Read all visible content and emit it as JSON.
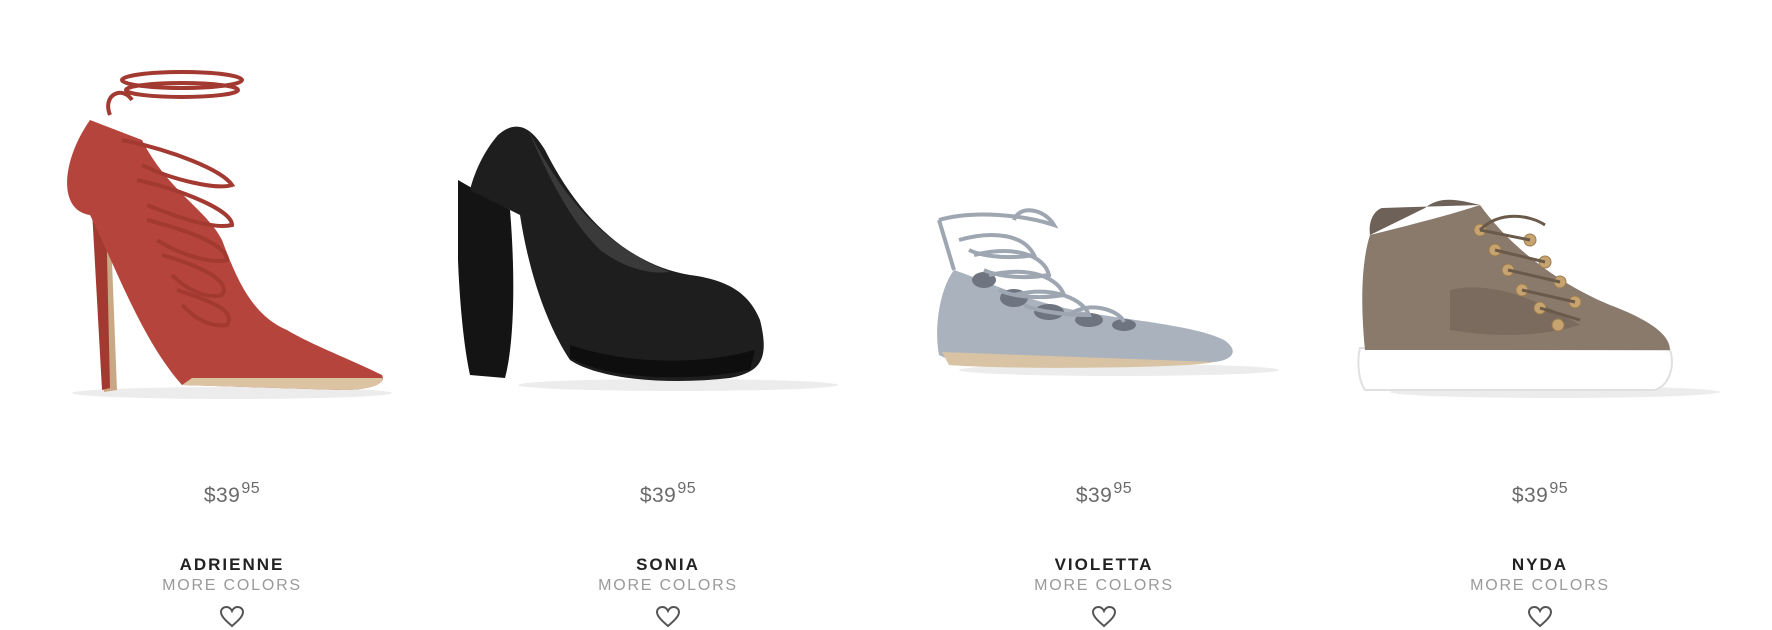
{
  "products": [
    {
      "price_dollars": "$39",
      "price_cents": "95",
      "name": "ADRIENNE",
      "more_colors": "MORE COLORS",
      "image_icon": "red-lace-up-pump-image",
      "color": "#b5453c"
    },
    {
      "price_dollars": "$39",
      "price_cents": "95",
      "name": "SONIA",
      "more_colors": "MORE COLORS",
      "image_icon": "black-platform-pump-image",
      "color": "#1c1c1c"
    },
    {
      "price_dollars": "$39",
      "price_cents": "95",
      "name": "VIOLETTA",
      "more_colors": "MORE COLORS",
      "image_icon": "grey-lace-up-flat-image",
      "color": "#a9b1bd"
    },
    {
      "price_dollars": "$39",
      "price_cents": "95",
      "name": "NYDA",
      "more_colors": "MORE COLORS",
      "image_icon": "taupe-high-top-sneaker-image",
      "color": "#8a7a6c"
    }
  ],
  "favorite_icon": "heart-outline-icon"
}
